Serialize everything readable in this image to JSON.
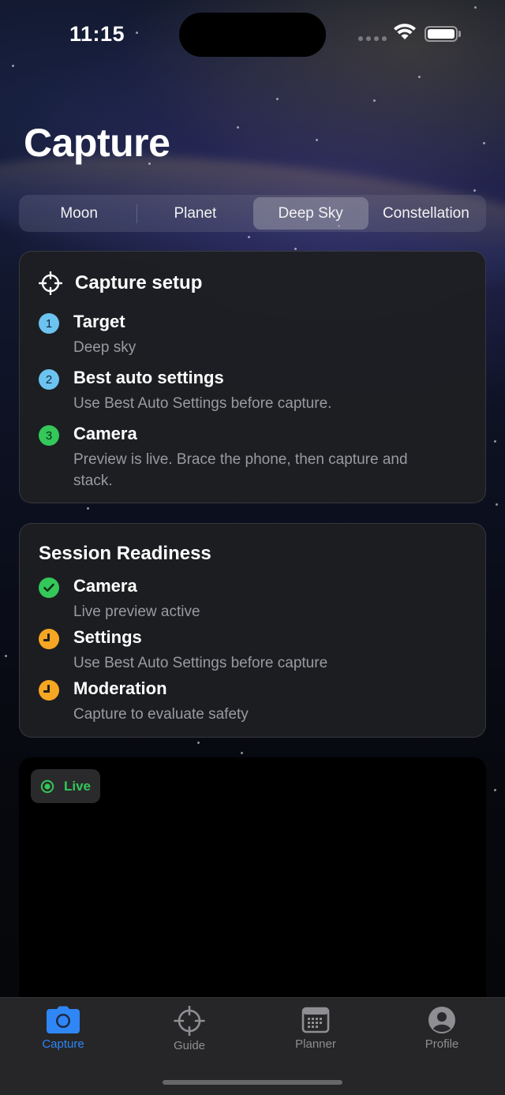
{
  "status_bar": {
    "time": "11:15"
  },
  "page": {
    "title": "Capture"
  },
  "segments": [
    {
      "label": "Moon"
    },
    {
      "label": "Planet"
    },
    {
      "label": "Deep Sky",
      "selected": true
    },
    {
      "label": "Constellation"
    }
  ],
  "capture_setup": {
    "title": "Capture setup",
    "icon": "crosshair-icon",
    "steps": [
      {
        "number": "1",
        "title": "Target",
        "subtitle": "Deep sky"
      },
      {
        "number": "2",
        "title": "Best auto settings",
        "subtitle": "Use Best Auto Settings before capture."
      },
      {
        "number": "3",
        "title": "Camera",
        "subtitle": "Preview is live. Brace the phone, then capture and stack."
      }
    ]
  },
  "session_readiness": {
    "title": "Session Readiness",
    "items": [
      {
        "status": "done",
        "title": "Camera",
        "subtitle": "Live preview active"
      },
      {
        "status": "pending",
        "title": "Settings",
        "subtitle": "Use Best Auto Settings before capture"
      },
      {
        "status": "pending",
        "title": "Moderation",
        "subtitle": "Capture to evaluate safety"
      }
    ]
  },
  "preview": {
    "badge": "Live"
  },
  "tabbar": [
    {
      "label": "Capture",
      "icon": "camera-icon",
      "active": true
    },
    {
      "label": "Guide",
      "icon": "crosshair-icon"
    },
    {
      "label": "Planner",
      "icon": "calendar-icon"
    },
    {
      "label": "Profile",
      "icon": "person-icon"
    }
  ],
  "colors": {
    "accent": "#2f86f6",
    "success": "#34c759",
    "warning": "#f5a623",
    "step_blue": "#6cc3f0"
  }
}
